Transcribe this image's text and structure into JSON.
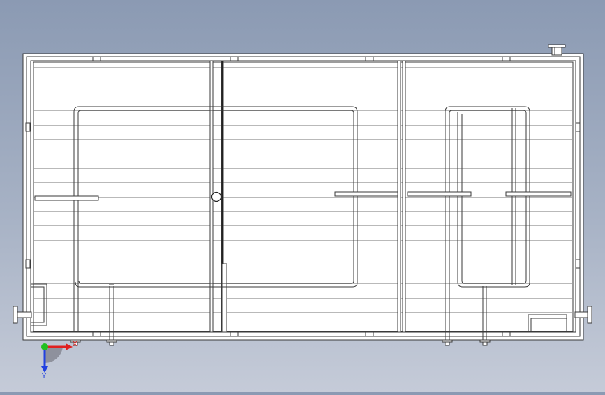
{
  "viewport": {
    "background_top": "#8b9ab3",
    "background_bottom": "#c5cbd8"
  },
  "drawing": {
    "line_color": "#3a3a3a",
    "tank_fill": "#ffffff",
    "shelf_line_color": "#b9b9b9",
    "shelf_count": 19
  },
  "triad": {
    "x_label": "X",
    "y_label": "Y",
    "x_color": "#e02020",
    "y_color": "#2040e0",
    "origin_color": "#20c020"
  }
}
